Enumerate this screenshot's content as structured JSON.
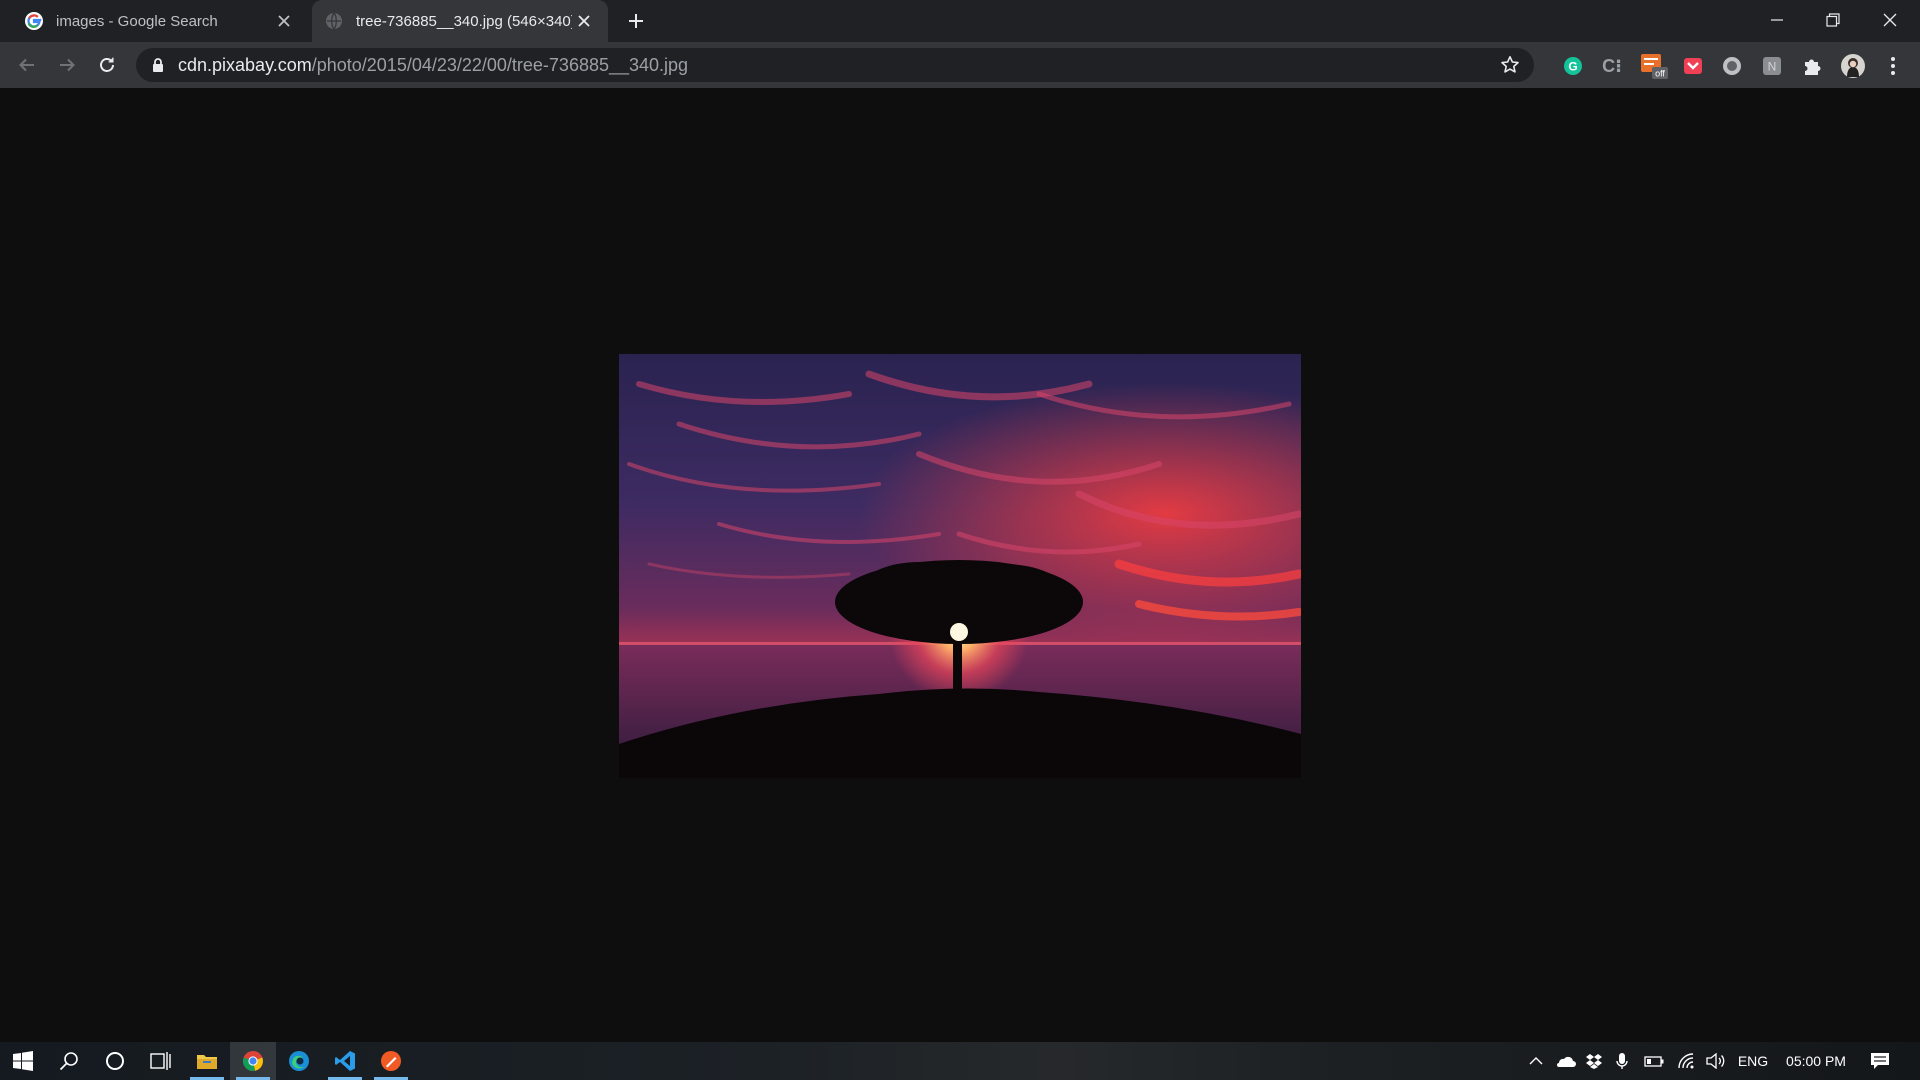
{
  "tabs": [
    {
      "title": "images - Google Search",
      "favicon": "google-g-icon",
      "active": false
    },
    {
      "title": "tree-736885__340.jpg (546×340)",
      "favicon": "globe-icon",
      "active": true
    }
  ],
  "address_bar": {
    "host": "cdn.pixabay.com",
    "path": "/photo/2015/04/23/22/00/tree-736885__340.jpg"
  },
  "extensions": [
    {
      "name": "grammarly-icon",
      "label": "G"
    },
    {
      "name": "extension-cb-icon",
      "label": "C⁝"
    },
    {
      "name": "extension-off-icon",
      "label": "off"
    },
    {
      "name": "pocket-icon",
      "label": ""
    },
    {
      "name": "circle-extension-icon",
      "label": ""
    },
    {
      "name": "extension-n-icon",
      "label": "N"
    },
    {
      "name": "puzzle-icon",
      "label": ""
    },
    {
      "name": "profile-avatar-icon",
      "label": ""
    },
    {
      "name": "menu-kebab-icon",
      "label": ""
    }
  ],
  "image": {
    "description_icon": "sunset-tree-photo"
  },
  "taskbar": {
    "language": "ENG",
    "time": "05:00 PM"
  },
  "colors": {
    "tabstrip": "#202124",
    "toolbar": "#35363a",
    "omnibox": "#202124",
    "page_bg": "#0e0e0e",
    "accent": "#76b9ed"
  }
}
